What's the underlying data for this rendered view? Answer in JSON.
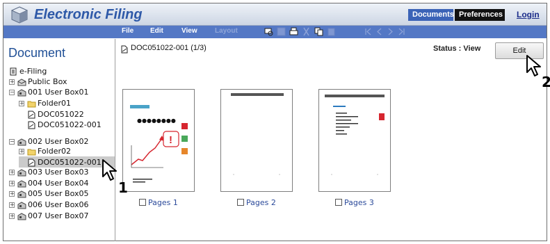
{
  "header": {
    "app_title": "Electronic Filing",
    "tabs": {
      "documents": "Documents",
      "preferences": "Preferences"
    },
    "login": "Login",
    "colors": {
      "accent": "#3b63b7",
      "menubar": "#5478c5",
      "title": "#2e59a8"
    }
  },
  "menu": {
    "items": [
      "File",
      "Edit",
      "View",
      "Layout"
    ],
    "toolbar_icons": [
      "preview-icon",
      "save-icon",
      "print-icon",
      "cut-icon",
      "copy-icon",
      "paste-icon",
      "first-page-icon",
      "previous-page-icon",
      "next-page-icon",
      "last-page-icon"
    ]
  },
  "sidebar": {
    "heading": "Document",
    "tree": [
      {
        "label": "e-Filing",
        "icon": "efiling-root-icon",
        "expander": ""
      },
      {
        "label": "Public Box",
        "icon": "public-box-icon",
        "expander": "+"
      },
      {
        "label": "001 User Box01",
        "icon": "user-box-icon",
        "expander": "−"
      },
      {
        "label": "Folder01",
        "icon": "folder-icon",
        "expander": "+"
      },
      {
        "label": "DOC051022",
        "icon": "document-icon",
        "expander": ""
      },
      {
        "label": "DOC051022-001",
        "icon": "document-icon",
        "expander": ""
      },
      {
        "label": "002 User Box02",
        "icon": "user-box-icon",
        "expander": "−"
      },
      {
        "label": "Folder02",
        "icon": "folder-icon",
        "expander": "+"
      },
      {
        "label": "DOC051022-001",
        "icon": "document-icon",
        "expander": ""
      },
      {
        "label": "003 User Box03",
        "icon": "user-box-icon",
        "expander": "+"
      },
      {
        "label": "004 User Box04",
        "icon": "user-box-icon",
        "expander": "+"
      },
      {
        "label": "005 User Box05",
        "icon": "user-box-icon",
        "expander": "+"
      },
      {
        "label": "006 User Box06",
        "icon": "user-box-icon",
        "expander": "+"
      },
      {
        "label": "007 User Box07",
        "icon": "user-box-icon",
        "expander": "+"
      }
    ]
  },
  "main": {
    "doc_path": "DOC051022-001 (1/3)",
    "status": "Status : View",
    "edit_button": "Edit",
    "pages": [
      {
        "label": "Pages 1",
        "thumbnail_text": "●●●●●●●●"
      },
      {
        "label": "Pages 2"
      },
      {
        "label": "Pages 3"
      }
    ]
  },
  "annotations": {
    "step1": "1",
    "step2": "2"
  }
}
